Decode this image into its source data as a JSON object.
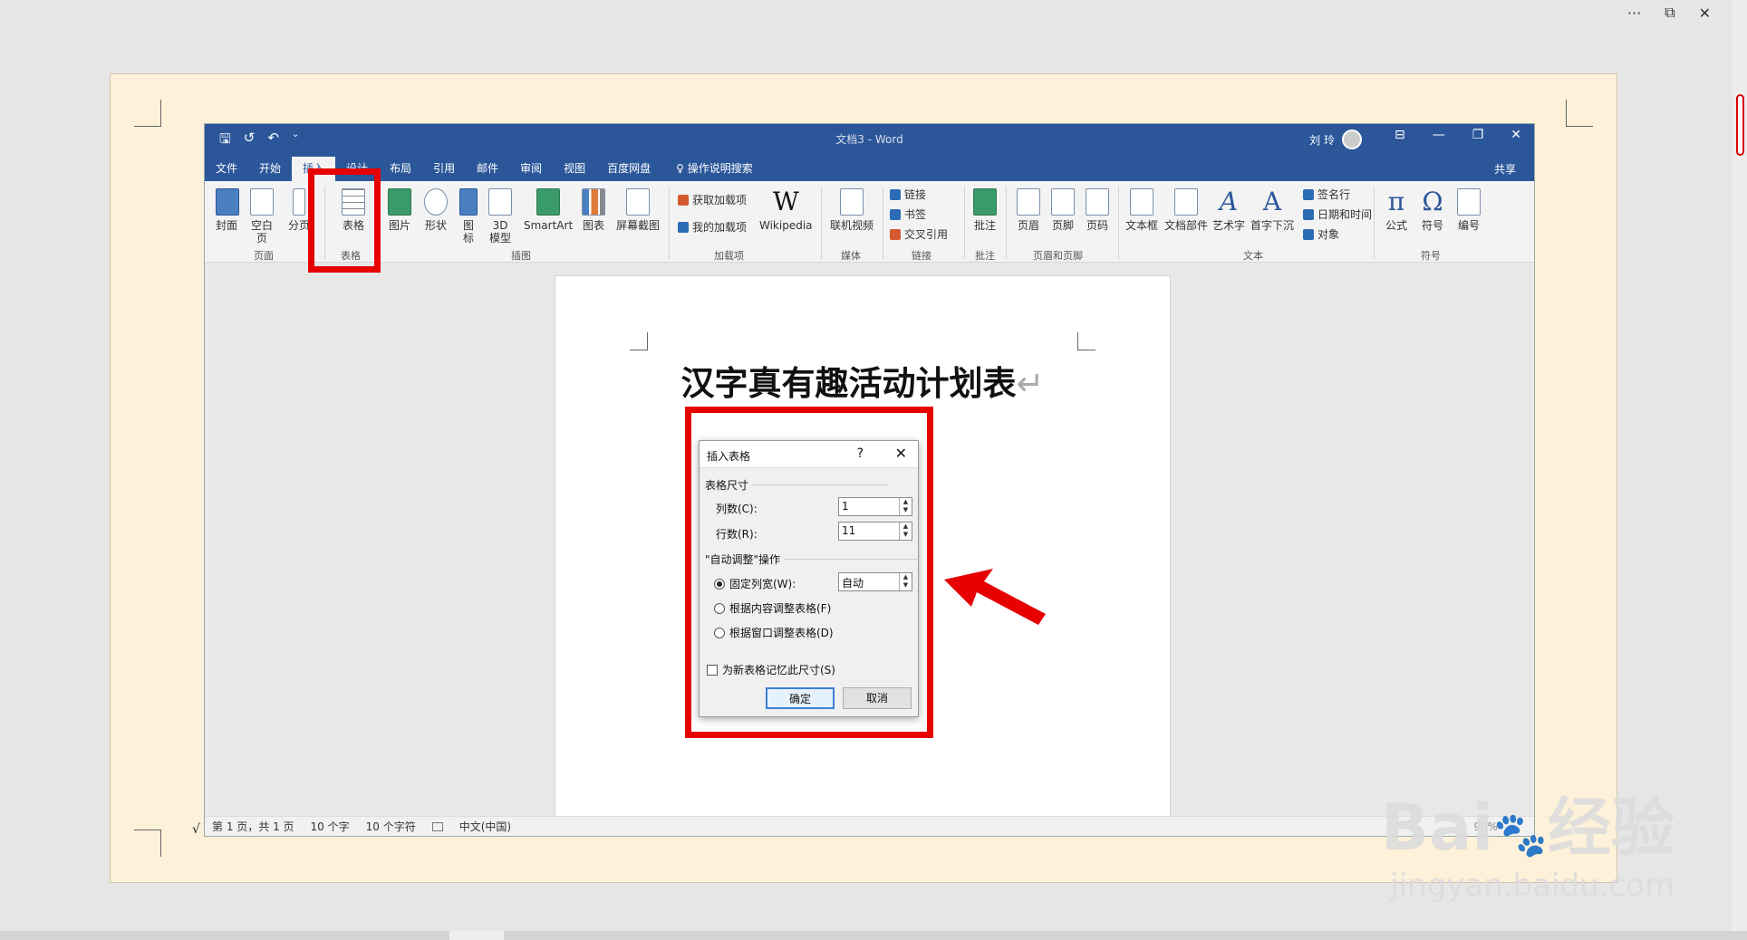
{
  "outer_controls": {
    "more": "···",
    "restore": "⧉",
    "close": "✕"
  },
  "qat": {
    "save": "🖫",
    "redo": "↺",
    "undo": "↶",
    "customize": "⌄"
  },
  "window": {
    "title": "文档3 - Word",
    "user_name": "刘 玲",
    "ribbon_display": "⊟",
    "minimize": "—",
    "maximize": "❐",
    "close": "✕"
  },
  "tabs": [
    "文件",
    "开始",
    "插入",
    "设计",
    "布局",
    "引用",
    "邮件",
    "审阅",
    "视图",
    "百度网盘"
  ],
  "tell_me": "操作说明搜索",
  "tell_me_icon": "♀",
  "share": "共享",
  "ribbon": {
    "cover": "封面",
    "blank_page": "空白页",
    "page_break": "分页",
    "table": "表格",
    "picture": "图片",
    "shapes": "形状",
    "icons": "图标",
    "model3d": "3D 模型",
    "smartart": "SmartArt",
    "chart": "图表",
    "screenshot": "屏幕截图",
    "get_addins": "获取加载项",
    "my_addins": "我的加载项",
    "wikipedia": "Wikipedia",
    "online_video": "联机视频",
    "link": "链接",
    "bookmark": "书签",
    "cross_ref": "交叉引用",
    "comment": "批注",
    "header": "页眉",
    "footer": "页脚",
    "page_number": "页码",
    "textbox": "文本框",
    "quick_parts": "文档部件",
    "wordart": "艺术字",
    "dropcap": "首字下沉",
    "signature": "签名行",
    "datetime": "日期和时间",
    "object": "对象",
    "equation": "公式",
    "symbol": "符号",
    "number": "编号"
  },
  "groups": {
    "pages": "页面",
    "tables": "表格",
    "illustrations": "插图",
    "addins": "加载项",
    "media": "媒体",
    "links": "链接",
    "comments": "批注",
    "header_footer": "页眉和页脚",
    "text": "文本",
    "symbols": "符号"
  },
  "document": {
    "heading": "汉字真有趣活动计划表",
    "para_mark": "↵"
  },
  "dialog": {
    "title": "插入表格",
    "help": "?",
    "close": "✕",
    "section_size": "表格尺寸",
    "cols_label": "列数(C):",
    "cols_value": "1",
    "rows_label": "行数(R):",
    "rows_value": "11",
    "section_autofit": "\"自动调整\"操作",
    "opt_fixed": "固定列宽(W):",
    "fixed_value": "自动",
    "opt_content": "根据内容调整表格(F)",
    "opt_window": "根据窗口调整表格(D)",
    "remember": "为新表格记忆此尺寸(S)",
    "ok": "确定",
    "cancel": "取消"
  },
  "status": {
    "check": "√",
    "page": "第 1 页，共 1 页",
    "words": "10 个字",
    "chars": "10 个字符",
    "lang": "中文(中国)",
    "zoom": "90%"
  },
  "watermark": {
    "brand": "Bai",
    "brand2": "经验",
    "url": "jingyan.baidu.com"
  },
  "colors": {
    "word_blue": "#2b579a",
    "highlight_red": "#e60000",
    "paper": "#fdf1d9"
  }
}
